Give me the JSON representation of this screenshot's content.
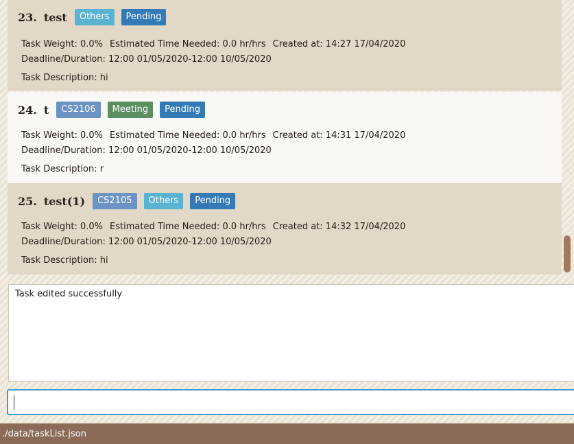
{
  "tasks": [
    {
      "index": "23.",
      "name": "test",
      "tags": [
        {
          "label": "Others",
          "color": "#5bb3d1"
        },
        {
          "label": "Pending",
          "color": "#337ab7"
        }
      ],
      "weight": "Task Weight: 0.0%",
      "time_needed": "Estimated Time Needed: 0.0 hr/hrs",
      "created": "Created at: 14:27 17/04/2020",
      "deadline": "Deadline/Duration: 12:00 01/05/2020-12:00 10/05/2020",
      "description": "Task Description: hi"
    },
    {
      "index": "24.",
      "name": "t",
      "tags": [
        {
          "label": "CS2106",
          "color": "#6b93c4"
        },
        {
          "label": "Meeting",
          "color": "#5c8f5f"
        },
        {
          "label": "Pending",
          "color": "#337ab7"
        }
      ],
      "weight": "Task Weight: 0.0%",
      "time_needed": "Estimated Time Needed: 0.0 hr/hrs",
      "created": "Created at: 14:31 17/04/2020",
      "deadline": "Deadline/Duration: 12:00 01/05/2020-12:00 10/05/2020",
      "description": "Task Description: r"
    },
    {
      "index": "25.",
      "name": "test(1)",
      "tags": [
        {
          "label": "CS2105",
          "color": "#6b93c4"
        },
        {
          "label": "Others",
          "color": "#5bb3d1"
        },
        {
          "label": "Pending",
          "color": "#337ab7"
        }
      ],
      "weight": "Task Weight: 0.0%",
      "time_needed": "Estimated Time Needed: 0.0 hr/hrs",
      "created": "Created at: 14:32 17/04/2020",
      "deadline": "Deadline/Duration: 12:00 01/05/2020-12:00 10/05/2020",
      "description": "Task Description: hi"
    }
  ],
  "result": "Task edited successfully",
  "command_input": "",
  "status_bar": "./data/taskList.json",
  "colors": {
    "card_odd": "#e2d8c7",
    "card_even": "#faf8f4",
    "status_bar": "#8b6a57",
    "focus_border": "#3a9bd0",
    "scroll_thumb": "#a07a5c"
  }
}
